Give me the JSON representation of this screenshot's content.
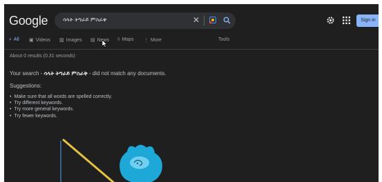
{
  "header": {
    "logo": "Google",
    "query": "ሳላት ትግራይ ምስራቅ",
    "sign_in": "Sign in"
  },
  "tabs": [
    {
      "label": "All",
      "icon": "search-icon",
      "active": true
    },
    {
      "label": "Videos",
      "icon": "video-icon"
    },
    {
      "label": "Images",
      "icon": "image-icon"
    },
    {
      "label": "News",
      "icon": "news-icon"
    },
    {
      "label": "Maps",
      "icon": "map-pin-icon"
    },
    {
      "label": "More",
      "icon": "more-vert-icon"
    }
  ],
  "tools": "Tools",
  "results": {
    "stats": "About 0 results (0.31 seconds)",
    "message_prefix": "Your search - ",
    "message_query": "ሳላት ትግራይ ምስራቅ",
    "message_suffix": " - did not match any documents.",
    "suggestions_heading": "Suggestions:",
    "suggestions": [
      "Make sure that all words are spelled correctly.",
      "Try different keywords.",
      "Try more general keywords.",
      "Try fewer keywords."
    ]
  },
  "colors": {
    "background": "#1f1f1f",
    "accent": "#8ab4f8",
    "search_box": "#303134"
  }
}
